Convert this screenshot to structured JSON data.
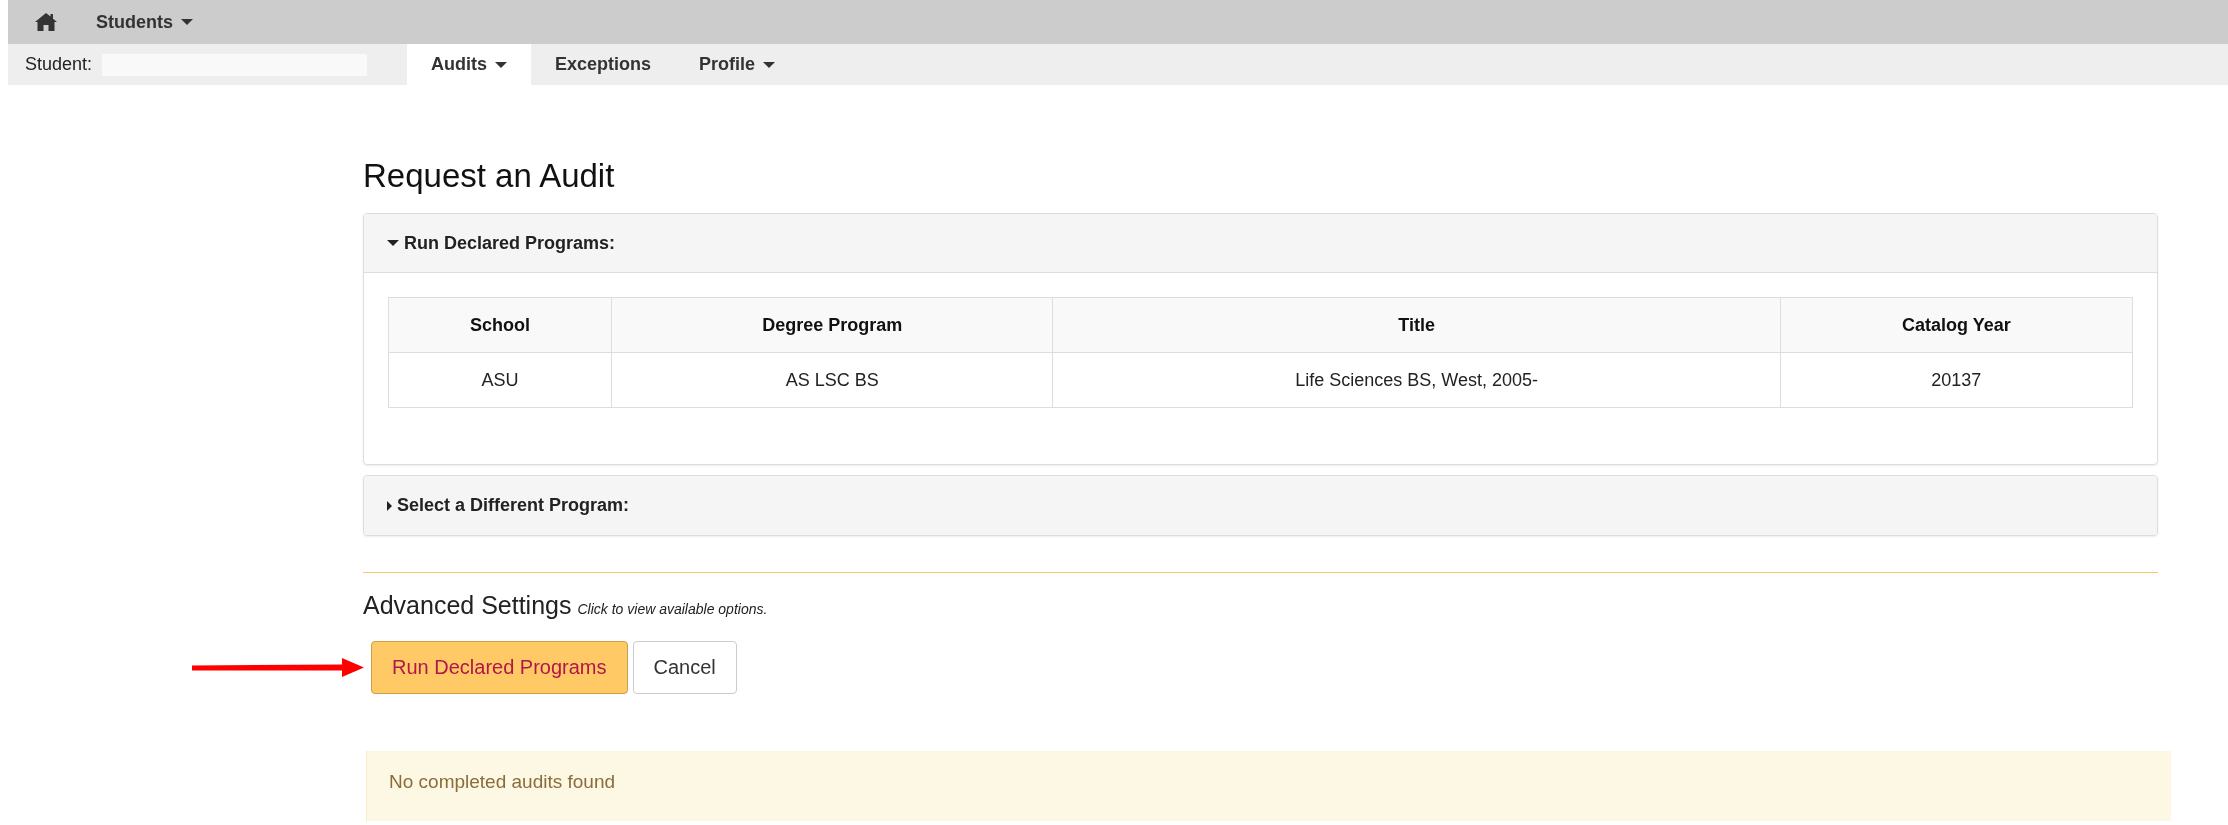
{
  "top_nav": {
    "menu": {
      "label": "Students"
    }
  },
  "sub_nav": {
    "student_label": "Student:",
    "tabs": [
      {
        "label": "Audits",
        "selected": true,
        "dropdown": true
      },
      {
        "label": "Exceptions",
        "selected": false,
        "dropdown": false
      },
      {
        "label": "Profile",
        "selected": false,
        "dropdown": true
      }
    ]
  },
  "page_title": "Request an Audit",
  "panels": [
    {
      "title": "Run Declared Programs:",
      "expanded": true,
      "table": {
        "columns": [
          "School",
          "Degree Program",
          "Title",
          "Catalog Year"
        ],
        "rows": [
          [
            "ASU",
            "AS LSC BS",
            "Life Sciences BS, West, 2005-",
            "20137"
          ]
        ]
      }
    },
    {
      "title": "Select a Different Program:",
      "expanded": false
    }
  ],
  "advanced": {
    "title": "Advanced Settings",
    "hint": "Click to view available options."
  },
  "buttons": [
    {
      "label": "Run Declared Programs",
      "kind": "primary"
    },
    {
      "label": "Cancel",
      "kind": "default"
    }
  ],
  "alert": "No completed audits found"
}
